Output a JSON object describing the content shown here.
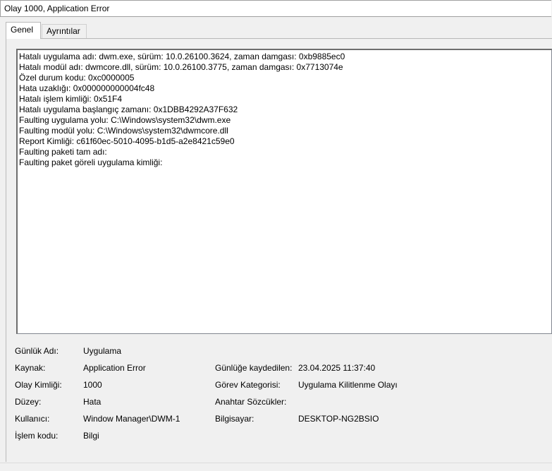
{
  "window": {
    "title": "Olay 1000, Application Error"
  },
  "tabs": [
    {
      "label": "Genel",
      "active": true
    },
    {
      "label": "Ayrıntılar",
      "active": false
    }
  ],
  "description_lines": [
    "Hatalı uygulama adı: dwm.exe, sürüm: 10.0.26100.3624, zaman damgası: 0xb9885ec0",
    "Hatalı modül adı: dwmcore.dll, sürüm: 10.0.26100.3775, zaman damgası: 0x7713074e",
    "Özel durum kodu: 0xc0000005",
    "Hata uzaklığı: 0x000000000004fc48",
    "Hatalı işlem kimliği: 0x51F4",
    "Hatalı uygulama başlangıç zamanı: 0x1DBB4292A37F632",
    "Faulting uygulama yolu: C:\\Windows\\system32\\dwm.exe",
    "Faulting modül yolu: C:\\Windows\\system32\\dwmcore.dll",
    "Report Kimliği: c61f60ec-5010-4095-b1d5-a2e8421c59e0",
    "Faulting paketi tam adı:",
    "Faulting paket göreli uygulama kimliği:"
  ],
  "details": {
    "log_name_label": "Günlük Adı:",
    "log_name_value": "Uygulama",
    "source_label": "Kaynak:",
    "source_value": "Application Error",
    "logged_label": "Günlüğe kaydedilen:",
    "logged_value": "23.04.2025 11:37:40",
    "event_id_label": "Olay Kimliği:",
    "event_id_value": "1000",
    "task_category_label": "Görev Kategorisi:",
    "task_category_value": "Uygulama Kilitlenme Olayı",
    "level_label": "Düzey:",
    "level_value": "Hata",
    "keywords_label": "Anahtar Sözcükler:",
    "keywords_value": "",
    "user_label": "Kullanıcı:",
    "user_value": "Window Manager\\DWM-1",
    "computer_label": "Bilgisayar:",
    "computer_value": "DESKTOP-NG2BSIO",
    "opcode_label": "İşlem kodu:",
    "opcode_value": "Bilgi"
  }
}
